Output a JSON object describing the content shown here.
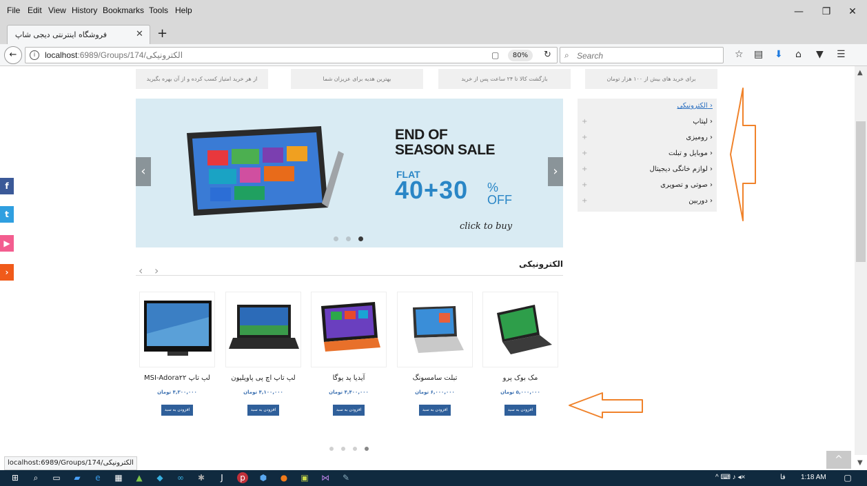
{
  "menubar": {
    "items": [
      "File",
      "Edit",
      "View",
      "History",
      "Bookmarks",
      "Tools",
      "Help"
    ],
    "window_controls": [
      "—",
      "❐",
      "✕"
    ]
  },
  "tab": {
    "title": "فروشگاه اینترنتی دیجی شاپ",
    "close": "✕",
    "new_tab": "+"
  },
  "navbar": {
    "back": "←",
    "info": "i",
    "url_host": "localhost",
    "url_rest": ":6989/Groups/174/الکترونیکی",
    "reader": "▢",
    "zoom": "80%",
    "reload": "↻",
    "search_icon": "⌕",
    "search_placeholder": "Search",
    "toolbar_icons": [
      "☆",
      "▤",
      "⬇",
      "⌂",
      "▼",
      "☰"
    ]
  },
  "info_boxes": [
    "از هر خرید امتیاز کسب کرده و از آن بهره بگیرید",
    "بهترین هدیه برای عزیزان شما",
    "بازگشت کالا تا ۲۴ ساعت پس از خرید",
    "برای خرید های بیش از ۱۰۰ هزار تومان"
  ],
  "slider": {
    "headline_1": "END OF",
    "headline_2": "SEASON SALE",
    "flat": "FLAT",
    "numbers": "40+30",
    "percent": "%",
    "off": "OFF",
    "cta": "click to buy",
    "prev": "‹",
    "next": "›",
    "dots": 3,
    "active_dot": 3
  },
  "categories": [
    "الکترونیکی",
    "لپتاپ",
    "رومیزی",
    "موبایل و تبلت",
    "لوازم خانگی دیجیتال",
    "صوتی و تصویری",
    "دوربین"
  ],
  "section": {
    "title": "الکترونیکی",
    "prev": "‹",
    "next": "›"
  },
  "products": [
    {
      "name": "مک بوک پرو",
      "price": "۵,۰۰۰,۰۰۰ تومان",
      "button": "افزودن به سبد"
    },
    {
      "name": "تبلت سامسونگ",
      "price": "۶,۰۰۰,۰۰۰ تومان",
      "button": "افزودن به سبد"
    },
    {
      "name": "آیدیا پد یوگا",
      "price": "۴,۴۰۰,۰۰۰ تومان",
      "button": "افزودن به سبد"
    },
    {
      "name": "لپ تاپ اچ پی پاویلیون",
      "price": "۴,۱۰۰,۰۰۰ تومان",
      "button": "افزودن به سبد"
    },
    {
      "name": "لپ تاپ MSI-Adora۲۲",
      "price": "۴,۳۰۰,۰۰۰ تومان",
      "button": "افزودن به سبد"
    }
  ],
  "social": [
    "f",
    "t",
    "▶",
    "›"
  ],
  "status_tip": "localhost:6989/Groups/174/الکترونیکی",
  "scroll_top": "^",
  "taskbar": {
    "tray_lang": "فا",
    "time": "1:18 AM"
  },
  "colors": {
    "annotation": "#f0822a",
    "facebook": "#3b5998",
    "twitter": "#2f9fe0",
    "youtube": "#f35d8f",
    "share": "#f05a1a",
    "button": "#2f5f9a"
  }
}
